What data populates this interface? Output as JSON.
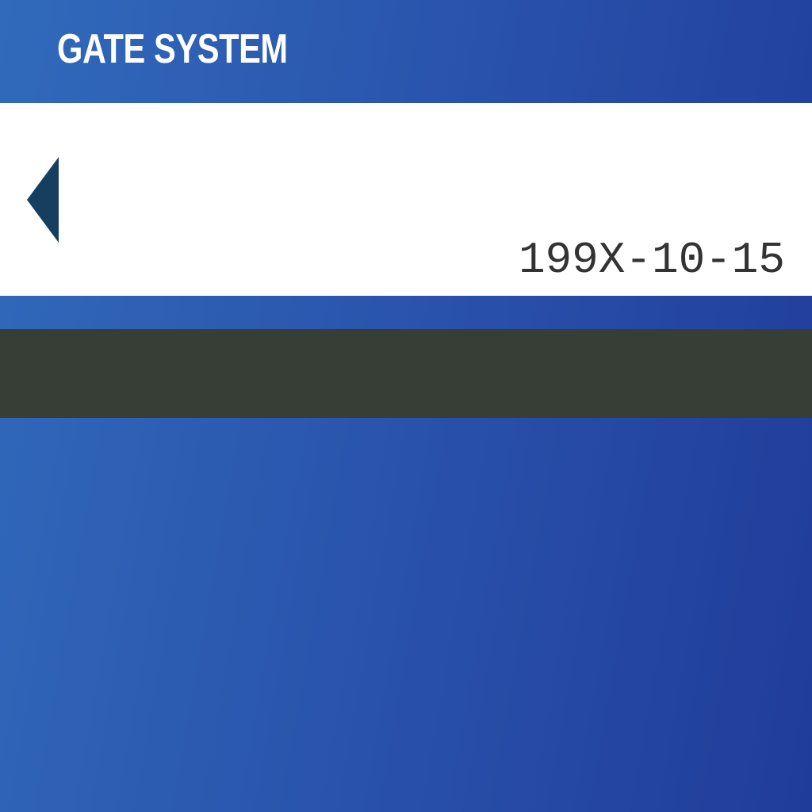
{
  "header": {
    "title": "GATE SYSTEM"
  },
  "date_panel": {
    "date": "199X-10-15",
    "back_icon": "triangle-left-icon"
  },
  "colors": {
    "background_start": "#316abb",
    "background_end": "#203c9a",
    "panel": "#ffffff",
    "back_arrow": "#153e5f",
    "date_text": "#333333",
    "status_bar": "#363e36"
  }
}
